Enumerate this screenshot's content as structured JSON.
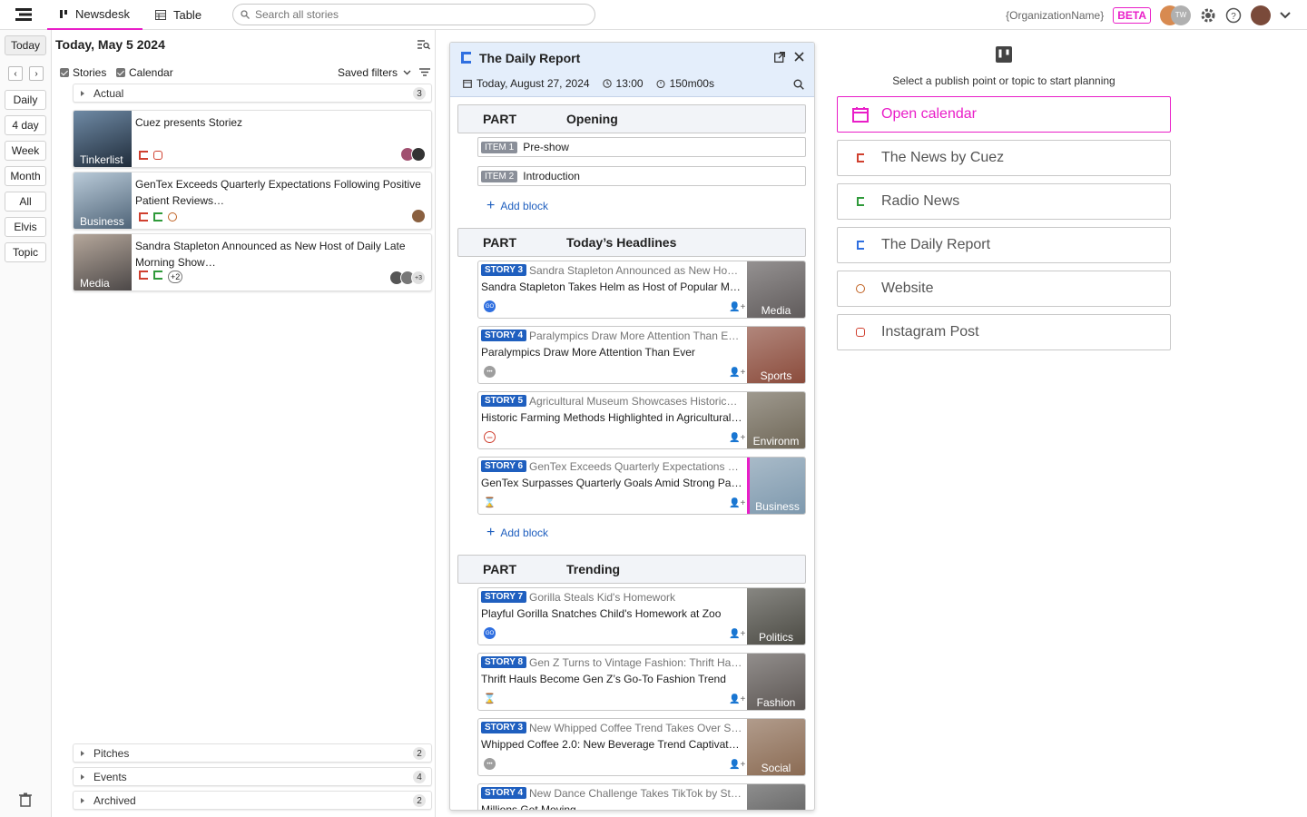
{
  "nav": {
    "tab_newsdesk": "Newsdesk",
    "tab_table": "Table",
    "search_placeholder": "Search all stories",
    "org": "{OrganizationName}",
    "beta": "BETA",
    "avatar_initials": "TW"
  },
  "rail": {
    "today": "Today",
    "buttons": [
      "Daily",
      "4 day",
      "Week",
      "Month",
      "All",
      "Elvis",
      "Topic"
    ]
  },
  "stories": {
    "date": "Today, May 5 2024",
    "check_stories": "Stories",
    "check_calendar": "Calendar",
    "saved_filters": "Saved filters",
    "groups": {
      "actual": {
        "label": "Actual",
        "count": "3"
      },
      "pitches": {
        "label": "Pitches",
        "count": "2"
      },
      "events": {
        "label": "Events",
        "count": "4"
      },
      "archived": {
        "label": "Archived",
        "count": "2"
      }
    },
    "cards": [
      {
        "title": "Cuez presents Storiez",
        "tag": "Tinkerlist",
        "thumb": "#34465a",
        "extra": ""
      },
      {
        "title": "GenTex Exceeds Quarterly Expectations Following Positive Patient Reviews…",
        "tag": "Business",
        "thumb": "#7e97ad",
        "extra": ""
      },
      {
        "title": "Sandra Stapleton Announced as New Host of Daily Late Morning Show…",
        "tag": "Media",
        "thumb": "#6d6a6a",
        "extra": "+2",
        "more": "+3"
      }
    ]
  },
  "rundown": {
    "title": "The Daily Report",
    "date": "Today, August 27, 2024",
    "time": "13:00",
    "duration": "150m00s",
    "part_label": "PART",
    "add_block": "Add block",
    "parts": [
      "Opening",
      "Today’s Headlines",
      "Trending"
    ],
    "items": [
      {
        "badge": "ITEM 1",
        "text": "Pre-show"
      },
      {
        "badge": "ITEM 2",
        "text": "Introduction"
      }
    ],
    "stories": [
      {
        "badge": "STORY 3",
        "t1": "Sandra Stapleton Announced as New Host…",
        "t2": "Sandra Stapleton Takes Helm as Host of Popular Mo…",
        "tag": "Media",
        "thumb": "#5f5a5a",
        "status": "#2f6fe0",
        "status_text": "GO"
      },
      {
        "badge": "STORY 4",
        "t1": "Paralympics Draw More Attention Than Ev…",
        "t2": "Paralympics Draw More Attention Than Ever",
        "tag": "Sports",
        "thumb": "#8a4a3a",
        "status": "#9e9e9e",
        "status_text": "•••"
      },
      {
        "badge": "STORY 5",
        "t1": "Agricultural Museum Showcases Historic…",
        "t2": "Historic Farming Methods Highlighted in Agricultural…",
        "tag": "Environm",
        "thumb": "#6e6656",
        "status": "#d04030",
        "status_text": "−"
      },
      {
        "badge": "STORY 6",
        "t1": "GenTex Exceeds Quarterly Expectations Fo…",
        "t2": "GenTex Surpasses Quarterly Goals Amid Strong Pati…",
        "tag": "Business",
        "thumb": "#7d98ad",
        "status": "#ffffff",
        "status_text": "⌛"
      },
      {
        "badge": "STORY 7",
        "t1": "Gorilla Steals Kid's Homework",
        "t2": "Playful Gorilla Snatches Child's Homework at Zoo",
        "tag": "Politics",
        "thumb": "#4b4a43",
        "status": "#2f6fe0",
        "status_text": "GO"
      },
      {
        "badge": "STORY 8",
        "t1": "Gen Z Turns to Vintage Fashion: Thrift Hau…",
        "t2": "Thrift Hauls Become Gen Z’s Go-To Fashion Trend",
        "tag": "Fashion",
        "thumb": "#5b5552",
        "status": "#ffffff",
        "status_text": "⌛"
      },
      {
        "badge": "STORY 3",
        "t1": "New Whipped Coffee Trend Takes Over So…",
        "t2": "Whipped Coffee 2.0: New Beverage Trend Captivates…",
        "tag": "Social",
        "thumb": "#8a6a52",
        "status": "#9e9e9e",
        "status_text": "•••"
      },
      {
        "badge": "STORY 4",
        "t1": "New Dance Challenge Takes TikTok by Sto…",
        "t2": "Millions Get Moving…",
        "tag": "",
        "thumb": "#555555",
        "status": "#9e9e9e",
        "status_text": ""
      }
    ]
  },
  "planning": {
    "hint": "Select a publish point or topic to start planning",
    "options": [
      {
        "label": "Open calendar",
        "color": "#e91ec8"
      },
      {
        "label": "The News by Cuez",
        "color": "#d0402f"
      },
      {
        "label": "Radio News",
        "color": "#2f9a3a"
      },
      {
        "label": "The Daily Report",
        "color": "#2f6fe0"
      },
      {
        "label": "Website",
        "color": "#c06020"
      },
      {
        "label": "Instagram Post",
        "color": "#d0402f"
      }
    ]
  },
  "colors": {
    "accent": "#e91ec8",
    "story_badge": "#1f5fbf"
  }
}
